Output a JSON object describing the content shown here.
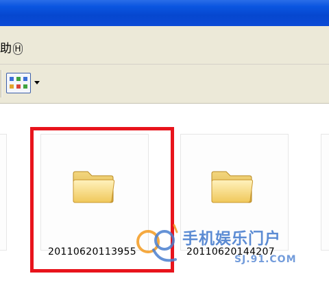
{
  "menu": {
    "help_label": "助",
    "help_mnemonic": "H"
  },
  "toolbar": {
    "view_button_icon": "view-thumbnails-icon",
    "dropdown_icon": "chevron-down-icon"
  },
  "folders": [
    {
      "name": "20110620113955",
      "icon": "folder-icon",
      "highlighted": true
    },
    {
      "name": "20110620144207",
      "icon": "folder-icon",
      "highlighted": false
    }
  ],
  "highlight_color": "#e8141c",
  "watermark": {
    "text": "手机娱乐门户",
    "url": "SJ.91.COM"
  }
}
